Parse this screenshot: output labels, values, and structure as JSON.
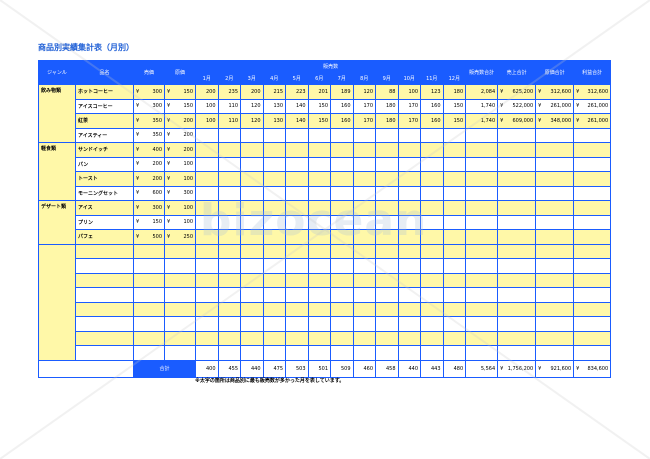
{
  "title": "商品別実績集計表（月別）",
  "headers": {
    "genre": "ジャンル",
    "name": "品名",
    "price": "売価",
    "cost": "原価",
    "sales_count": "販売数",
    "months": [
      "1月",
      "2月",
      "3月",
      "4月",
      "5月",
      "6月",
      "7月",
      "8月",
      "9月",
      "10月",
      "11月",
      "12月"
    ],
    "count_total": "販売数合計",
    "sales_total": "売上合計",
    "cost_total": "原価合計",
    "profit_total": "利益合計"
  },
  "rows": [
    {
      "genre": "飲み物類",
      "name": "ホットコーヒー",
      "price": "300",
      "cost": "150",
      "months": [
        "200",
        "235",
        "200",
        "215",
        "223",
        "201",
        "189",
        "120",
        "88",
        "100",
        "123",
        "180"
      ],
      "count": "2,084",
      "sales": "625,200",
      "costsum": "312,600",
      "profit": "312,600",
      "yellow": true
    },
    {
      "genre": "",
      "name": "アイスコーヒー",
      "price": "300",
      "cost": "150",
      "months": [
        "100",
        "110",
        "120",
        "130",
        "140",
        "150",
        "160",
        "170",
        "180",
        "170",
        "160",
        "150"
      ],
      "count": "1,740",
      "sales": "522,000",
      "costsum": "261,000",
      "profit": "261,000",
      "yellow": false
    },
    {
      "genre": "",
      "name": "紅茶",
      "price": "350",
      "cost": "200",
      "months": [
        "100",
        "110",
        "120",
        "130",
        "140",
        "150",
        "160",
        "170",
        "180",
        "170",
        "160",
        "150"
      ],
      "count": "1,740",
      "sales": "609,000",
      "costsum": "348,000",
      "profit": "261,000",
      "yellow": true
    },
    {
      "genre": "",
      "name": "アイスティー",
      "price": "350",
      "cost": "200",
      "months": [
        "",
        "",
        "",
        "",
        "",
        "",
        "",
        "",
        "",
        "",
        "",
        ""
      ],
      "count": "",
      "sales": "",
      "costsum": "",
      "profit": "",
      "yellow": false
    },
    {
      "genre": "軽食類",
      "name": "サンドイッチ",
      "price": "400",
      "cost": "200",
      "months": [
        "",
        "",
        "",
        "",
        "",
        "",
        "",
        "",
        "",
        "",
        "",
        ""
      ],
      "count": "",
      "sales": "",
      "costsum": "",
      "profit": "",
      "yellow": true
    },
    {
      "genre": "",
      "name": "パン",
      "price": "200",
      "cost": "100",
      "months": [
        "",
        "",
        "",
        "",
        "",
        "",
        "",
        "",
        "",
        "",
        "",
        ""
      ],
      "count": "",
      "sales": "",
      "costsum": "",
      "profit": "",
      "yellow": false
    },
    {
      "genre": "",
      "name": "トースト",
      "price": "200",
      "cost": "100",
      "months": [
        "",
        "",
        "",
        "",
        "",
        "",
        "",
        "",
        "",
        "",
        "",
        ""
      ],
      "count": "",
      "sales": "",
      "costsum": "",
      "profit": "",
      "yellow": true
    },
    {
      "genre": "",
      "name": "モーニングセット",
      "price": "600",
      "cost": "300",
      "months": [
        "",
        "",
        "",
        "",
        "",
        "",
        "",
        "",
        "",
        "",
        "",
        ""
      ],
      "count": "",
      "sales": "",
      "costsum": "",
      "profit": "",
      "yellow": false
    },
    {
      "genre": "デザート類",
      "name": "アイス",
      "price": "300",
      "cost": "100",
      "months": [
        "",
        "",
        "",
        "",
        "",
        "",
        "",
        "",
        "",
        "",
        "",
        ""
      ],
      "count": "",
      "sales": "",
      "costsum": "",
      "profit": "",
      "yellow": true
    },
    {
      "genre": "",
      "name": "プリン",
      "price": "150",
      "cost": "100",
      "months": [
        "",
        "",
        "",
        "",
        "",
        "",
        "",
        "",
        "",
        "",
        "",
        ""
      ],
      "count": "",
      "sales": "",
      "costsum": "",
      "profit": "",
      "yellow": false
    },
    {
      "genre": "",
      "name": "パフェ",
      "price": "500",
      "cost": "250",
      "months": [
        "",
        "",
        "",
        "",
        "",
        "",
        "",
        "",
        "",
        "",
        "",
        ""
      ],
      "count": "",
      "sales": "",
      "costsum": "",
      "profit": "",
      "yellow": true
    }
  ],
  "blank_rows": 8,
  "totals": {
    "label": "合計",
    "months": [
      "400",
      "455",
      "440",
      "475",
      "503",
      "501",
      "509",
      "460",
      "458",
      "440",
      "443",
      "480"
    ],
    "count": "5,564",
    "sales": "1,756,200",
    "costsum": "921,600",
    "profit": "834,600"
  },
  "yen": "¥",
  "note": "※太字の箇所は商品別に最も販売数が多かった月を表しています。",
  "watermark": "bizocean",
  "colors": {
    "header_blue": "#1a5cff",
    "row_yellow": "#fff8a8",
    "title_blue": "#1f5fd6"
  }
}
